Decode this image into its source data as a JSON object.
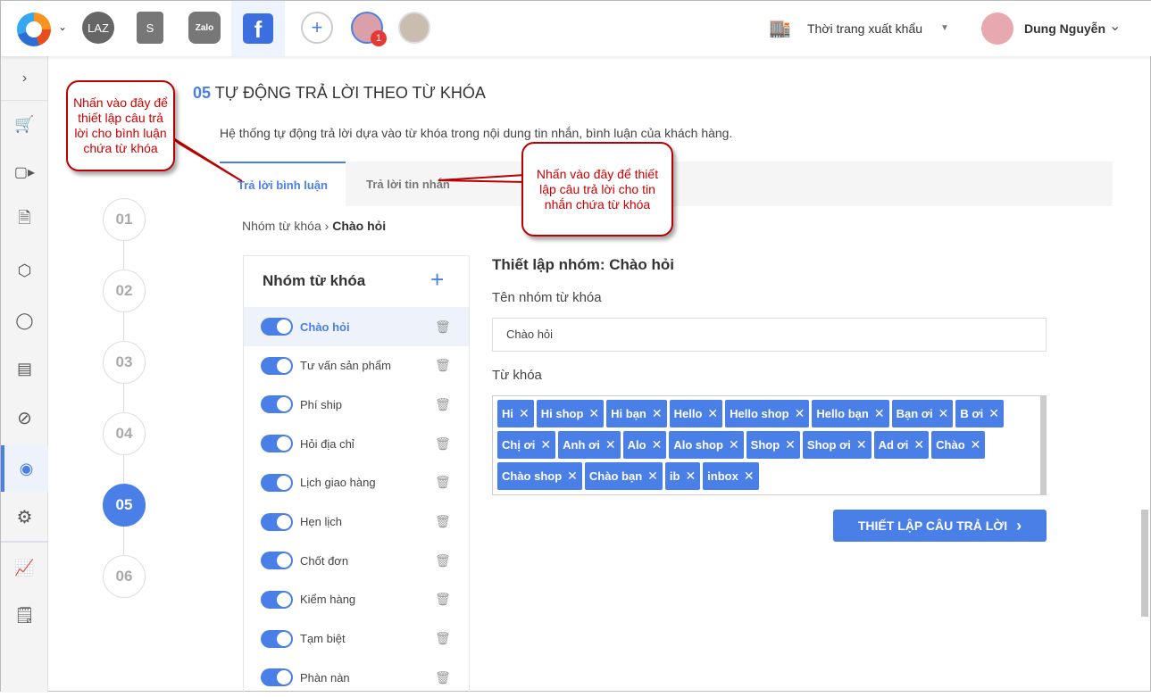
{
  "topbar": {
    "lazada": "LAZ",
    "zalo": "Zalo",
    "fb": "f",
    "badge": "1",
    "shop_name": "Thời trang xuất khẩu",
    "user_name": "Dung Nguyễn"
  },
  "steps": [
    "01",
    "02",
    "03",
    "04",
    "05",
    "06"
  ],
  "section": {
    "number": "05",
    "title": "TỰ ĐỘNG TRẢ LỜI THEO TỪ KHÓA",
    "description": "Hệ thống tự động trả lời dựa vào từ khóa trong nội dung tin nhắn, bình luận của khách hàng."
  },
  "tabs": [
    "Trả lời bình luận",
    "Trả lời tin nhắn"
  ],
  "breadcrumb": {
    "root": "Nhóm từ khóa",
    "current": "Chào hỏi"
  },
  "groups": {
    "title": "Nhóm từ khóa",
    "items": [
      "Chào hỏi",
      "Tư vấn sản phẩm",
      "Phí ship",
      "Hỏi địa chỉ",
      "Lịch giao hàng",
      "Hẹn lịch",
      "Chốt đơn",
      "Kiểm hàng",
      "Tạm biệt",
      "Phàn nàn"
    ]
  },
  "form": {
    "title": "Thiết lập nhóm: Chào hỏi",
    "name_label": "Tên nhóm từ khóa",
    "name_value": "Chào hỏi",
    "keywords_label": "Từ khóa",
    "keywords": [
      "Hi",
      "Hi shop",
      "Hi bạn",
      "Hello",
      "Hello shop",
      "Hello bạn",
      "Bạn ơi",
      "B ơi",
      "Chị ơi",
      "Anh ơi",
      "Alo",
      "Alo shop",
      "Shop",
      "Shop ơi",
      "Ad ơi",
      "Chào",
      "Chào shop",
      "Chào bạn",
      "ib",
      "inbox"
    ],
    "submit": "THIẾT LẬP CÂU TRẢ LỜI"
  },
  "callouts": [
    "Nhấn vào đây để thiết lập câu trả lời cho bình luận chứa từ khóa",
    "Nhấn vào đây để thiết lập câu trả lời cho tin nhắn chứa từ khóa"
  ],
  "colors": {
    "accent": "#4a7fe8",
    "callout": "#c00000"
  }
}
